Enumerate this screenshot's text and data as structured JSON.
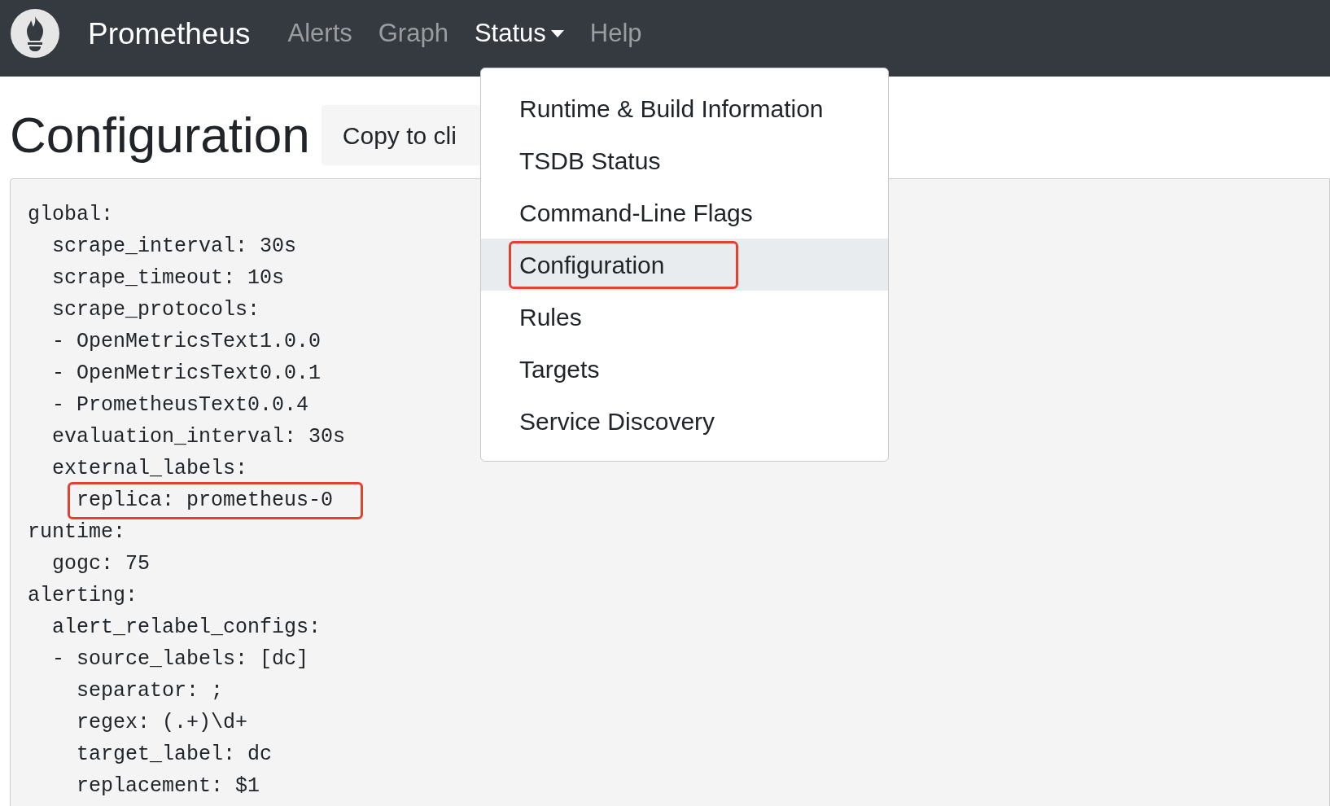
{
  "navbar": {
    "brand": "Prometheus",
    "links": [
      {
        "label": "Alerts",
        "selected": false,
        "dropdown": false
      },
      {
        "label": "Graph",
        "selected": false,
        "dropdown": false
      },
      {
        "label": "Status",
        "selected": true,
        "dropdown": true
      },
      {
        "label": "Help",
        "selected": false,
        "dropdown": false
      }
    ]
  },
  "dropdown": {
    "items": [
      {
        "label": "Runtime & Build Information",
        "selected": false,
        "highlighted": false
      },
      {
        "label": "TSDB Status",
        "selected": false,
        "highlighted": false
      },
      {
        "label": "Command-Line Flags",
        "selected": false,
        "highlighted": false
      },
      {
        "label": "Configuration",
        "selected": true,
        "highlighted": true
      },
      {
        "label": "Rules",
        "selected": false,
        "highlighted": false
      },
      {
        "label": "Targets",
        "selected": false,
        "highlighted": false
      },
      {
        "label": "Service Discovery",
        "selected": false,
        "highlighted": false
      }
    ]
  },
  "heading": "Configuration",
  "copy_button": "Copy to cli",
  "config_lines": [
    {
      "text": "global:",
      "highlighted": false
    },
    {
      "text": "  scrape_interval: 30s",
      "highlighted": false
    },
    {
      "text": "  scrape_timeout: 10s",
      "highlighted": false
    },
    {
      "text": "  scrape_protocols:",
      "highlighted": false
    },
    {
      "text": "  - OpenMetricsText1.0.0",
      "highlighted": false
    },
    {
      "text": "  - OpenMetricsText0.0.1",
      "highlighted": false
    },
    {
      "text": "  - PrometheusText0.0.4",
      "highlighted": false
    },
    {
      "text": "  evaluation_interval: 30s",
      "highlighted": false
    },
    {
      "text": "  external_labels:",
      "highlighted": false
    },
    {
      "text": "    replica: prometheus-0",
      "highlighted": true
    },
    {
      "text": "runtime:",
      "highlighted": false
    },
    {
      "text": "  gogc: 75",
      "highlighted": false
    },
    {
      "text": "alerting:",
      "highlighted": false
    },
    {
      "text": "  alert_relabel_configs:",
      "highlighted": false
    },
    {
      "text": "  - source_labels: [dc]",
      "highlighted": false
    },
    {
      "text": "    separator: ;",
      "highlighted": false
    },
    {
      "text": "    regex: (.+)\\d+",
      "highlighted": false
    },
    {
      "text": "    target_label: dc",
      "highlighted": false
    },
    {
      "text": "    replacement: $1",
      "highlighted": false
    }
  ]
}
